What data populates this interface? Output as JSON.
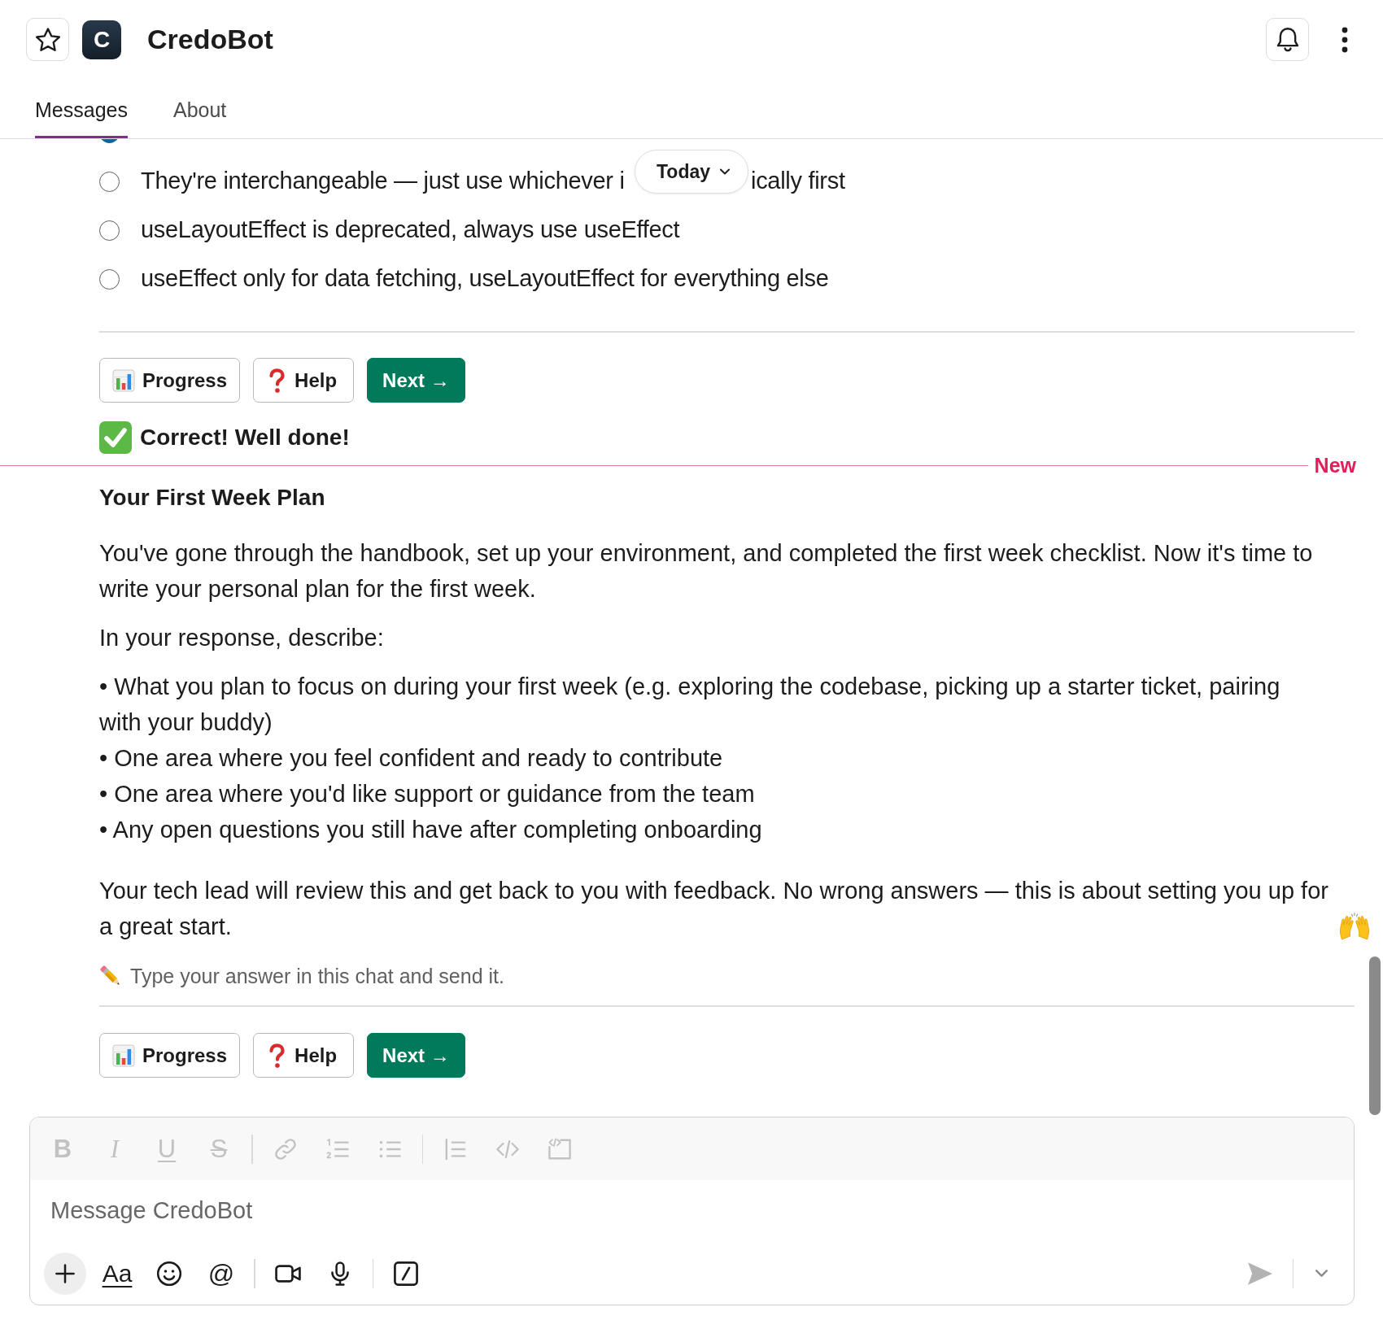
{
  "header": {
    "starred": false,
    "logo_letter": "C",
    "title": "CredoBot"
  },
  "tabs": [
    {
      "label": "Messages",
      "selected": true
    },
    {
      "label": "About",
      "selected": false
    }
  ],
  "date_divider": {
    "label": "Today"
  },
  "feed": [
    {
      "kind": "quiz",
      "options": [
        {
          "selected": true
        },
        {
          "text": "They're interchangeable — just use whichever i",
          "text_after_overlay": "ically first",
          "selected": false
        },
        {
          "text": "useLayoutEffect is deprecated, always use useEffect",
          "selected": false
        },
        {
          "text": "useEffect only for data fetching, useLayoutEffect for everything else",
          "selected": false
        }
      ],
      "actions": [
        {
          "kind": "progress",
          "label": "Progress"
        },
        {
          "kind": "help",
          "label": "Help"
        },
        {
          "kind": "next",
          "label": "Next →"
        }
      ],
      "result": "Correct! Well done!"
    },
    {
      "kind": "new_divider",
      "label": "New"
    },
    {
      "kind": "task",
      "title": "Your First Week Plan",
      "paragraphs": [
        "You've gone through the handbook, set up your environment, and completed the first week checklist. Now it's time to write your personal plan for the first week.",
        "In your response, describe:"
      ],
      "bullets": [
        "• What you plan to focus on during your first week (e.g. exploring the codebase, picking up a starter ticket, pairing with your buddy)",
        "• One area where you feel confident and ready to contribute",
        "• One area where you'd like support or guidance from the team",
        "• Any open questions you still have after completing onboarding"
      ],
      "closing": "Your tech lead will review this and get back to you with feedback. No wrong answers — this is about setting you up for a great start.",
      "hint": "Type your answer in this chat and send it.",
      "actions": [
        {
          "kind": "progress",
          "label": "Progress"
        },
        {
          "kind": "help",
          "label": "Help"
        },
        {
          "kind": "next",
          "label": "Next →"
        }
      ]
    }
  ],
  "composer": {
    "format_toolbar": {
      "disabled": true,
      "letters": [
        "B",
        "I",
        "U",
        "S"
      ]
    },
    "placeholder": "Message CredoBot",
    "formatting_label": "Aa",
    "mention_label": "@",
    "send_disabled": true
  }
}
